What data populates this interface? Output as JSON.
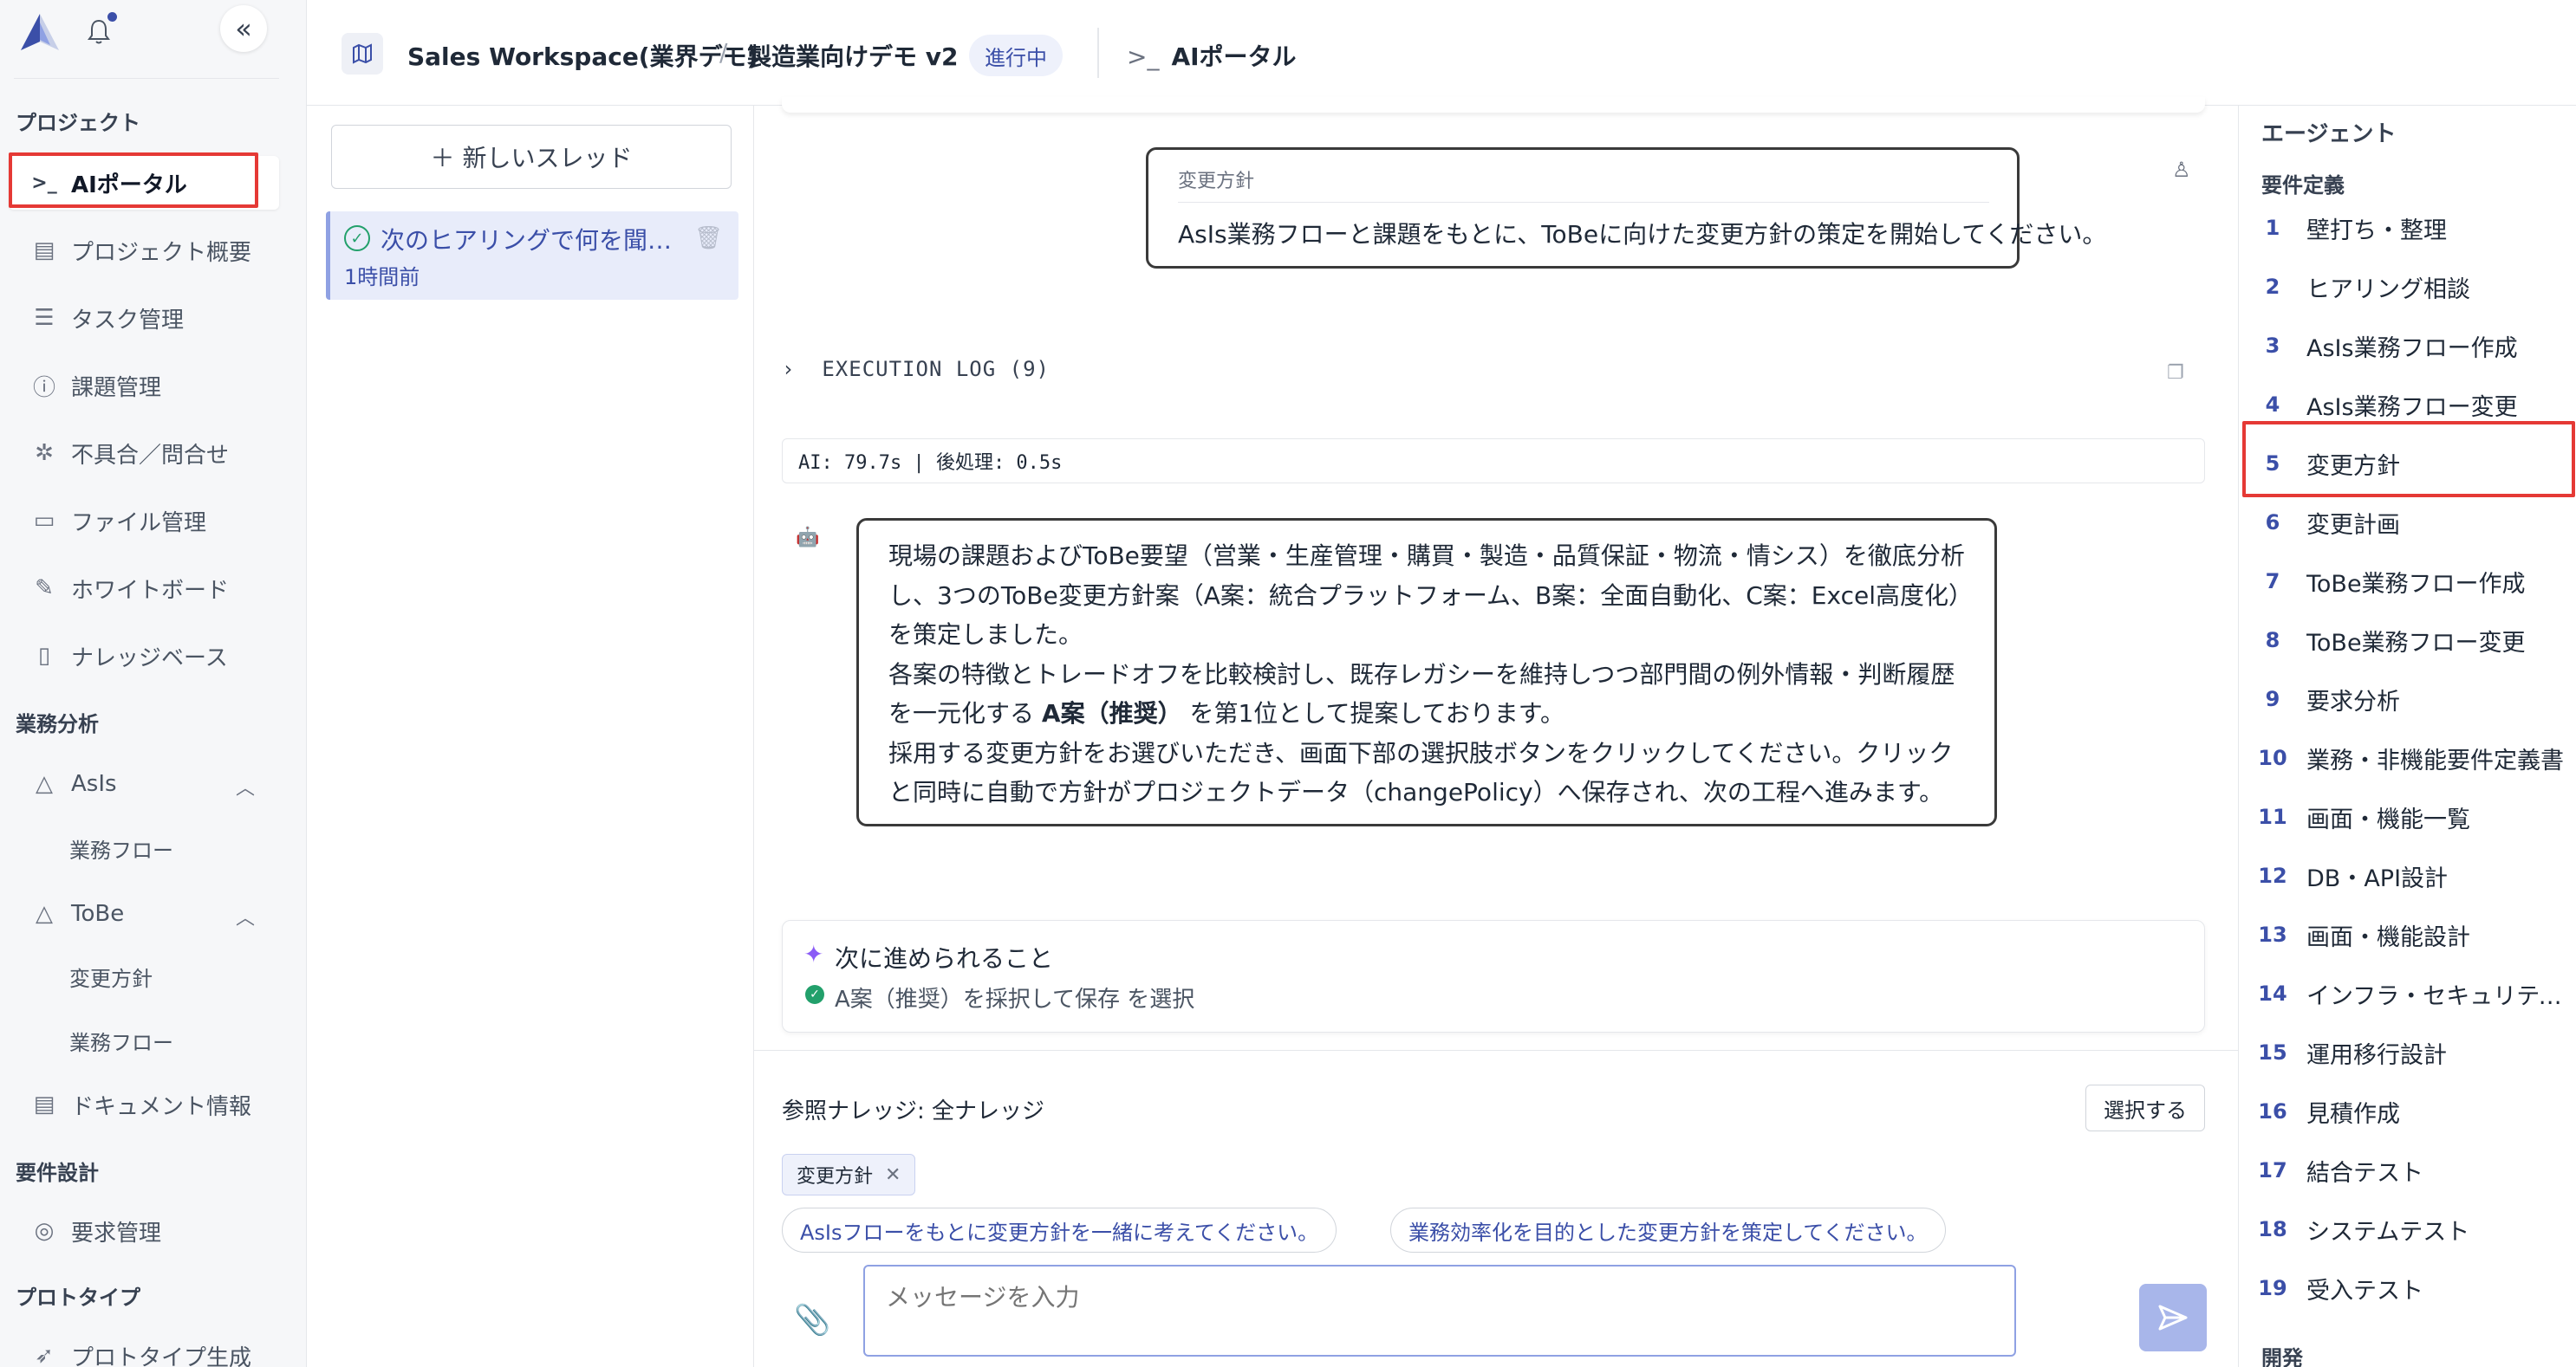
{
  "colors": {
    "accent": "#3b4fa8",
    "highlight_box": "#e53935",
    "status_green": "#22a06b",
    "sparkle": "#8b5cf6"
  },
  "sidebar": {
    "collapse_icon": "«",
    "sections": {
      "project": "プロジェクト",
      "business_analysis": "業務分析",
      "requirements_design": "要件設計",
      "prototype": "プロトタイプ"
    },
    "items": [
      {
        "label": "AIポータル",
        "icon": "terminal-icon",
        "glyph": ">_"
      },
      {
        "label": "プロジェクト概要",
        "icon": "clipboard-icon",
        "glyph": "▤"
      },
      {
        "label": "タスク管理",
        "icon": "checklist-icon",
        "glyph": "☰"
      },
      {
        "label": "課題管理",
        "icon": "alert-circle-icon",
        "glyph": "ⓘ"
      },
      {
        "label": "不具合／問合せ",
        "icon": "bug-icon",
        "glyph": "✲"
      },
      {
        "label": "ファイル管理",
        "icon": "folder-icon",
        "glyph": "▭"
      },
      {
        "label": "ホワイトボード",
        "icon": "brush-icon",
        "glyph": "✎"
      },
      {
        "label": "ナレッジベース",
        "icon": "book-icon",
        "glyph": "▯"
      }
    ],
    "asis": {
      "label": "AsIs",
      "sub": [
        "業務フロー"
      ]
    },
    "tobe": {
      "label": "ToBe",
      "sub": [
        "変更方針",
        "業務フロー"
      ]
    },
    "document_info": "ドキュメント情報",
    "requirements_mgmt": "要求管理",
    "prototype_gen": "プロトタイプ生成"
  },
  "header": {
    "workspace": "Sales Workspace(業界デモ)",
    "separator": "/",
    "project": "製造業向けデモ v2",
    "status": "進行中",
    "portal_icon": ">_",
    "portal": "AIポータル"
  },
  "threads": {
    "new_thread": "＋ 新しいスレッド",
    "items": [
      {
        "title": "次のヒアリングで何を聞く...",
        "time": "1時間前"
      }
    ]
  },
  "chat": {
    "user_message": {
      "label": "変更方針",
      "text": "AsIs業務フローと課題をもとに、ToBeに向けた変更方針の策定を開始してください。"
    },
    "execution_log": "EXECUTION LOG (9)",
    "timing": "AI: 79.7s  |  後処理: 0.5s",
    "ai_message": {
      "p1": "現場の課題およびToBe要望（営業・生産管理・購買・製造・品質保証・物流・情シス）を徹底分析し、3つのToBe変更方針案（A案：統合プラットフォーム、B案：全面自動化、C案：Excel高度化）を策定しました。",
      "p2_before": "各案の特徴とトレードオフを比較検討し、既存レガシーを維持しつつ部門間の例外情報・判断履歴を一元化する ",
      "p2_bold": "A案（推奨）",
      "p2_after": " を第1位として提案しております。",
      "p3": "採用する変更方針をお選びいただき、画面下部の選択肢ボタンをクリックしてください。クリックと同時に自動で方針がプロジェクトデータ（changePolicy）へ保存され、次の工程へ進みます。"
    },
    "next_steps": {
      "title": "次に進められること",
      "option": "A案（推奨）を採択して保存 を選択"
    },
    "knowledge_label": "参照ナレッジ: 全ナレッジ",
    "select_button": "選択する",
    "tag": "変更方針",
    "suggestions": [
      "AsIsフローをもとに変更方針を一緒に考えてください。",
      "業務効率化を目的とした変更方針を策定してください。"
    ],
    "input_placeholder": "メッセージを入力"
  },
  "agents": {
    "title": "エージェント",
    "group_requirements": "要件定義",
    "group_dev": "開発",
    "items": [
      {
        "num": "1",
        "label": "壁打ち・整理"
      },
      {
        "num": "2",
        "label": "ヒアリング相談"
      },
      {
        "num": "3",
        "label": "AsIs業務フロー作成"
      },
      {
        "num": "4",
        "label": "AsIs業務フロー変更"
      },
      {
        "num": "5",
        "label": "変更方針"
      },
      {
        "num": "6",
        "label": "変更計画"
      },
      {
        "num": "7",
        "label": "ToBe業務フロー作成"
      },
      {
        "num": "8",
        "label": "ToBe業務フロー変更"
      },
      {
        "num": "9",
        "label": "要求分析"
      },
      {
        "num": "10",
        "label": "業務・非機能要件定義書"
      },
      {
        "num": "11",
        "label": "画面・機能一覧"
      },
      {
        "num": "12",
        "label": "DB・API設計"
      },
      {
        "num": "13",
        "label": "画面・機能設計"
      },
      {
        "num": "14",
        "label": "インフラ・セキュリティ..."
      },
      {
        "num": "15",
        "label": "運用移行設計"
      },
      {
        "num": "16",
        "label": "見積作成"
      },
      {
        "num": "17",
        "label": "結合テスト"
      },
      {
        "num": "18",
        "label": "システムテスト"
      },
      {
        "num": "19",
        "label": "受入テスト"
      }
    ]
  }
}
